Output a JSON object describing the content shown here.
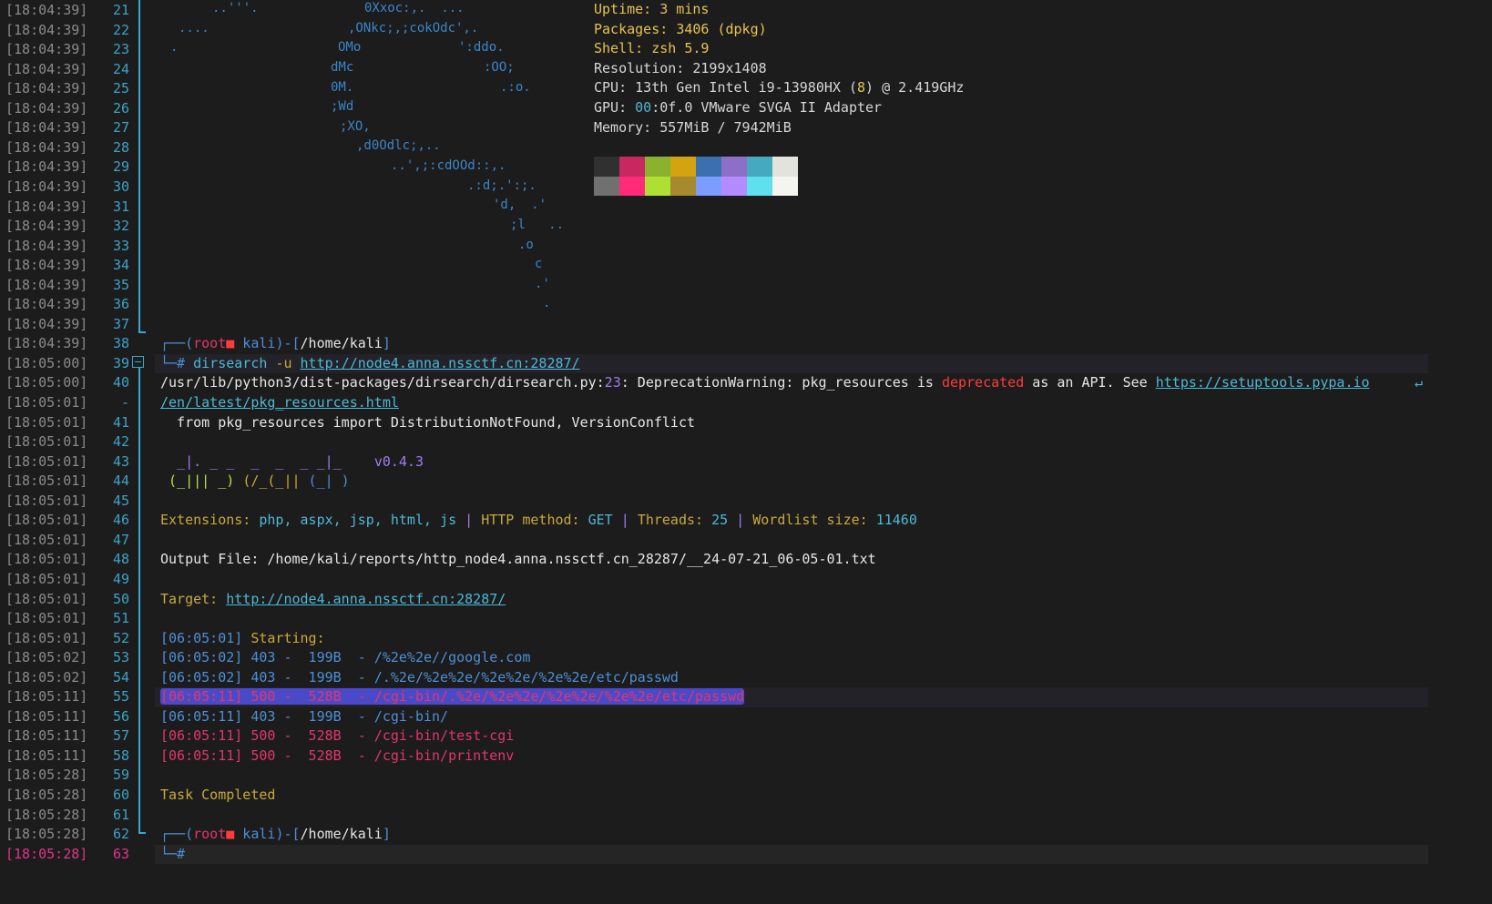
{
  "art": [
    "..'''.",
    "0Xxoc:,.  ...",
    "....",
    ",ONkc;,;cokOdc',.",
    ".",
    "OMo",
    "':ddo.",
    "dMc",
    ":OO;",
    "0M.",
    ".:o.",
    ";Wd",
    ";XO,",
    ",d0Odlc;,..",
    "..',;:cdOOd::,.",
    ".:d;.':;.",
    "'d,  .'",
    ";l   ..",
    ".o",
    "c",
    ".'",
    "."
  ],
  "neofetch": {
    "uptime_k": "Uptime:",
    "uptime_v": "3 mins",
    "packages_k": "Packages:",
    "packages_v": "3406 (dpkg)",
    "shell_k": "Shell:",
    "shell_v": "zsh 5.9",
    "resolution_k": "Resolution:",
    "resolution_v": "2199x1408",
    "cpu_k": "CPU:",
    "cpu_v1": "13th Gen Intel i9-13980HX (",
    "cpu_cores": "8",
    "cpu_v2": ") @ 2.419GHz",
    "gpu_k": "GPU:",
    "gpu_bus": "00",
    "gpu_v": ":0f.0 VMware SVGA II Adapter",
    "memory_k": "Memory:",
    "memory_v": "557MiB / 7942MiB",
    "palette_top": [
      "#303030",
      "#c8275f",
      "#8ab22f",
      "#d3a310",
      "#3a70b0",
      "#8c6fc8",
      "#45a9bf",
      "#e3e3dd"
    ],
    "palette_bottom": [
      "#707070",
      "#ff2a78",
      "#aee033",
      "#a68a2d",
      "#7c9cff",
      "#b38bff",
      "#5ee0ef",
      "#f5f5ef"
    ]
  },
  "timestamps": [
    "[18:04:39]",
    "[18:04:39]",
    "[18:04:39]",
    "[18:04:39]",
    "[18:04:39]",
    "[18:04:39]",
    "[18:04:39]",
    "[18:04:39]",
    "[18:04:39]",
    "[18:04:39]",
    "[18:04:39]",
    "[18:04:39]",
    "[18:04:39]",
    "[18:04:39]",
    "[18:04:39]",
    "[18:04:39]",
    "[18:04:39]",
    "[18:04:39]",
    "[18:05:00]",
    "[18:05:01]",
    "[18:05:01]",
    "[18:05:01]",
    "[18:05:01]",
    "[18:05:01]",
    "[18:05:01]",
    "[18:05:01]",
    "[18:05:01]",
    "[18:05:01]",
    "[18:05:01]",
    "[18:05:01]",
    "[18:05:01]",
    "[18:05:01]",
    "[18:05:02]",
    "[18:05:02]",
    "[18:05:11]",
    "[18:05:11]",
    "[18:05:11]",
    "[18:05:11]",
    "[18:05:28]",
    "[18:05:28]",
    "[18:05:28]",
    "[18:05:28]",
    "[18:05:28]"
  ],
  "line_numbers": [
    "21",
    "22",
    "23",
    "24",
    "25",
    "26",
    "27",
    "28",
    "29",
    "30",
    "31",
    "32",
    "33",
    "34",
    "35",
    "36",
    "37",
    "38",
    "39",
    "40",
    "-",
    "41",
    "42",
    "43",
    "44",
    "45",
    "46",
    "47",
    "48",
    "49",
    "50",
    "51",
    "52",
    "53",
    "54",
    "55",
    "56",
    "57",
    "58",
    "59",
    "60",
    "61",
    "62",
    "63"
  ],
  "prompt1": {
    "corner": "┌──(",
    "user": "root",
    "skull": "■",
    "host": " kali",
    "mid": ")-[",
    "path": "/home/kali",
    "end": "]"
  },
  "cmd": {
    "lead": "└─#",
    "name": "dirsearch",
    "flag": "-u",
    "url": "http://node4.anna.nssctf.cn:28287/"
  },
  "warn": {
    "path": "/usr/lib/python3/dist-packages/dirsearch/dirsearch.py:",
    "lineno": "23",
    "msg1": ": DeprecationWarning: pkg_resources is ",
    "deprecated": "deprecated",
    "msg2": " as an API. See ",
    "link1": "https://setuptools.pypa.io",
    "wrap": "↵",
    "link2": "/en/latest/pkg_resources.html",
    "code": "  from pkg_resources import DistributionNotFound, VersionConflict"
  },
  "banner": {
    "l1a": "  _|. _ _  _  _  _ _|_    ",
    "version": "v0.4.3",
    "l2": " (_||| _) (/_(_|| (_| )"
  },
  "info": {
    "ext_k": "Extensions: ",
    "ext_v": "php, aspx, jsp, html, js",
    "sep": " | ",
    "method_k": "HTTP method: ",
    "method_v": "GET",
    "threads_k": "Threads: ",
    "threads_v": "25",
    "wl_k": "Wordlist size: ",
    "wl_v": "11460",
    "out_k": "Output File: ",
    "out_v": "/home/kali/reports/http_node4.anna.nssctf.cn_28287/__24-07-21_06-05-01.txt",
    "target_k": "Target: ",
    "target_v": "http://node4.anna.nssctf.cn:28287/",
    "start_ts": "[06:05:01]",
    "start_txt": " Starting:"
  },
  "results": [
    {
      "ts": "[06:05:02]",
      "code": "403",
      "size": "199B",
      "path": "/%2e%2e//google.com",
      "kind": "ok"
    },
    {
      "ts": "[06:05:02]",
      "code": "403",
      "size": "199B",
      "path": "/.%2e/%2e%2e/%2e%2e/%2e%2e/etc/passwd",
      "kind": "ok"
    },
    {
      "ts": "[06:05:11]",
      "code": "500",
      "size": "528B",
      "path": "/cgi-bin/.%2e/%2e%2e/%2e%2e/%2e%2e/etc/passwd",
      "kind": "err"
    },
    {
      "ts": "[06:05:11]",
      "code": "403",
      "size": "199B",
      "path": "/cgi-bin/",
      "kind": "ok"
    },
    {
      "ts": "[06:05:11]",
      "code": "500",
      "size": "528B",
      "path": "/cgi-bin/test-cgi",
      "kind": "err"
    },
    {
      "ts": "[06:05:11]",
      "code": "500",
      "size": "528B",
      "path": "/cgi-bin/printenv",
      "kind": "err"
    }
  ],
  "task_done": "Task Completed",
  "prompt_lead": "└─#"
}
